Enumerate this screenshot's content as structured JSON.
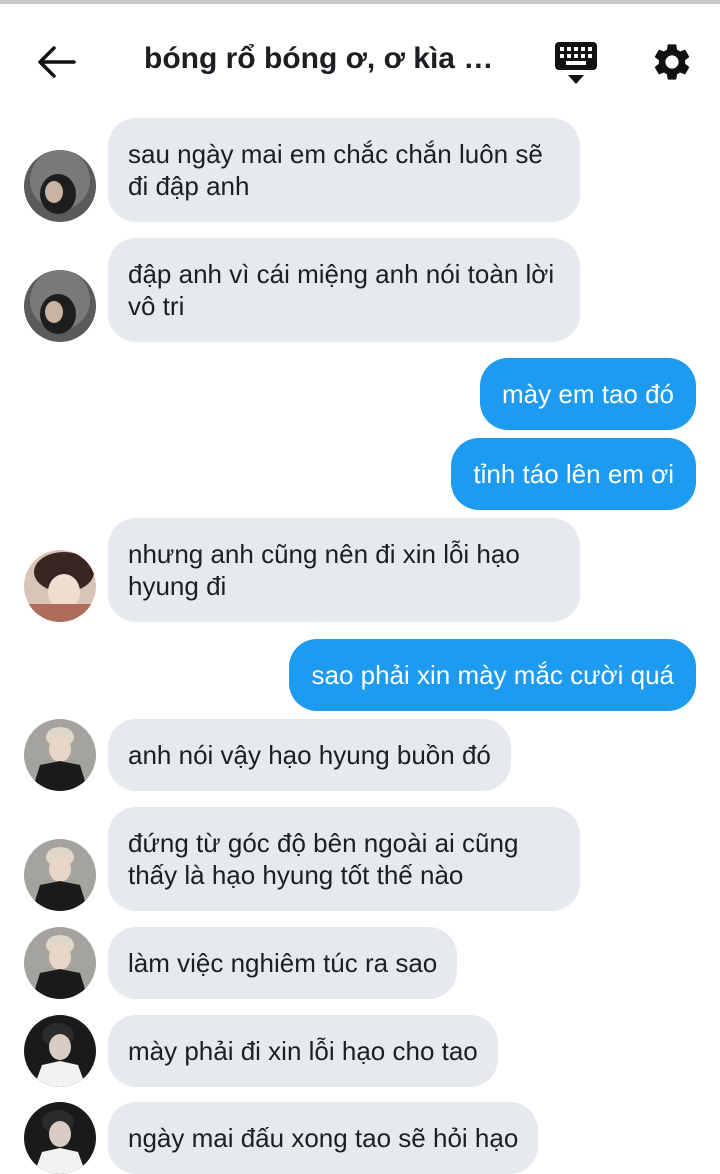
{
  "header": {
    "title": "bóng rổ bóng ơ, ơ kìa b...",
    "back_icon": "arrow-left-icon",
    "keyboard_icon": "keyboard-icon",
    "settings_icon": "gear-icon"
  },
  "colors": {
    "incoming_bubble": "#e6eaef",
    "outgoing_bubble": "#1d9bf0",
    "outgoing_text": "#ffffff",
    "text": "#1c1e21"
  },
  "messages": [
    {
      "side": "in",
      "avatar": "a1",
      "text": "sau ngày mai em chắc chắn luôn sẽ đi đập anh"
    },
    {
      "side": "in",
      "avatar": "a1",
      "text": "đập anh vì cái miệng anh nói toàn lời vô tri"
    },
    {
      "side": "out",
      "text": "mày em tao đó"
    },
    {
      "side": "out",
      "text": "tỉnh táo lên em ơi"
    },
    {
      "side": "in",
      "avatar": "a2",
      "text": "nhưng anh cũng nên đi xin lỗi hạo hyung đi"
    },
    {
      "side": "out",
      "text": "sao phải xin mày mắc cười quá"
    },
    {
      "side": "in",
      "avatar": "a3",
      "text": "anh nói vậy hạo hyung buồn đó"
    },
    {
      "side": "in",
      "avatar": "a3",
      "text": "đứng từ góc độ bên ngoài ai cũng thấy là hạo hyung tốt thế nào"
    },
    {
      "side": "in",
      "avatar": "a3",
      "text": "làm việc nghiêm túc ra sao"
    },
    {
      "side": "in",
      "avatar": "a4",
      "text": "mày phải đi xin lỗi hạo cho tao"
    },
    {
      "side": "in",
      "avatar": "a4",
      "text": "ngày mai đấu xong tao sẽ hỏi hạo"
    }
  ]
}
